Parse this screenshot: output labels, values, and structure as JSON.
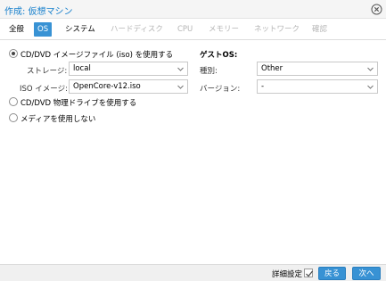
{
  "window": {
    "title": "作成: 仮想マシン"
  },
  "tabs": [
    {
      "label": "全般",
      "state": "normal"
    },
    {
      "label": "OS",
      "state": "active"
    },
    {
      "label": "システム",
      "state": "normal"
    },
    {
      "label": "ハードディスク",
      "state": "disabled"
    },
    {
      "label": "CPU",
      "state": "disabled"
    },
    {
      "label": "メモリー",
      "state": "disabled"
    },
    {
      "label": "ネットワーク",
      "state": "disabled"
    },
    {
      "label": "確認",
      "state": "disabled"
    }
  ],
  "media": {
    "use_iso_label": "CD/DVD イメージファイル (iso) を使用する",
    "storage_label": "ストレージ:",
    "storage_value": "local",
    "iso_label": "ISO イメージ:",
    "iso_value": "OpenCore-v12.iso",
    "physical_label": "CD/DVD 物理ドライブを使用する",
    "none_label": "メディアを使用しない",
    "selected": "use_iso"
  },
  "guest_os": {
    "title": "ゲストOS:",
    "type_label": "種別:",
    "type_value": "Other",
    "version_label": "バージョン:",
    "version_value": "-"
  },
  "footer": {
    "advanced_label": "詳細設定",
    "advanced_checked": true,
    "back_label": "戻る",
    "next_label": "次へ"
  },
  "colors": {
    "accent": "#3892d4",
    "title": "#157fcc"
  }
}
